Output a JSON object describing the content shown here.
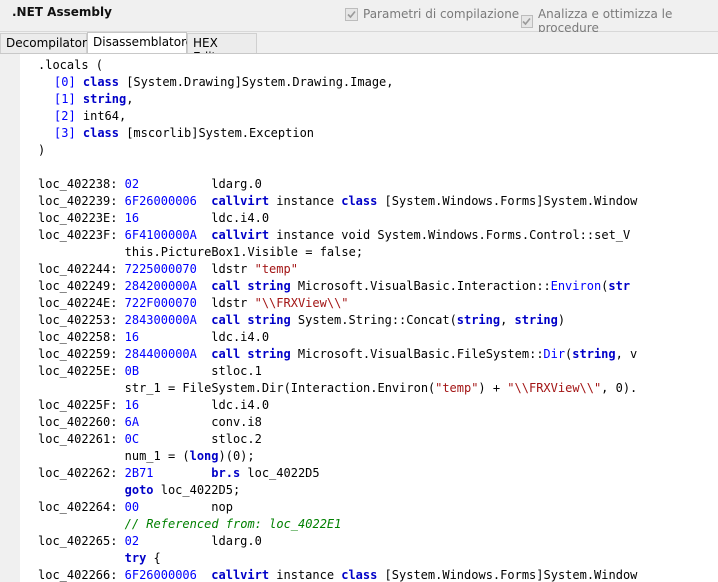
{
  "header": {
    "title": ".NET Assembly",
    "option1": "Parametri di compilazione",
    "option2": "Analizza e ottimizza le procedure"
  },
  "tabs": [
    "Decompilatore",
    "Disassemblatore",
    "HEX Editor"
  ],
  "code_lines": [
    {
      "x": 18,
      "segs": [
        {
          "t": ".locals (",
          "c": "plain"
        }
      ]
    },
    {
      "x": 34,
      "segs": [
        {
          "t": "[0]",
          "c": "num"
        },
        {
          "t": " class",
          "c": "kw"
        },
        {
          "t": " [System.Drawing]System.Drawing.Image,",
          "c": "plain"
        }
      ]
    },
    {
      "x": 34,
      "segs": [
        {
          "t": "[1]",
          "c": "num"
        },
        {
          "t": " string",
          "c": "kw"
        },
        {
          "t": ",",
          "c": "plain"
        }
      ]
    },
    {
      "x": 34,
      "segs": [
        {
          "t": "[2]",
          "c": "num"
        },
        {
          "t": " int64,",
          "c": "plain"
        }
      ]
    },
    {
      "x": 34,
      "segs": [
        {
          "t": "[3]",
          "c": "num"
        },
        {
          "t": " class",
          "c": "kw"
        },
        {
          "t": " [mscorlib]System.Exception",
          "c": "plain"
        }
      ]
    },
    {
      "x": 18,
      "segs": [
        {
          "t": ")",
          "c": "plain"
        }
      ]
    },
    {
      "x": 18,
      "segs": []
    },
    {
      "x": 18,
      "segs": [
        {
          "t": "loc_402238:",
          "c": "plain"
        },
        {
          "t": "02",
          "c": "num",
          "col": 12
        },
        {
          "t": "ldarg.0",
          "c": "plain",
          "col": 24
        }
      ]
    },
    {
      "x": 18,
      "segs": [
        {
          "t": "loc_402239:",
          "c": "plain"
        },
        {
          "t": "6F26000006",
          "c": "num",
          "col": 12
        },
        {
          "t": "callvirt",
          "c": "kw",
          "col": 24
        },
        {
          "t": "instance",
          "c": "plain",
          "col": 33
        },
        {
          "t": "class",
          "c": "kw",
          "col": 42
        },
        {
          "t": "[System.Windows.Forms]System.Window",
          "c": "plain",
          "col": 48
        }
      ]
    },
    {
      "x": 18,
      "segs": [
        {
          "t": "loc_40223E:",
          "c": "plain"
        },
        {
          "t": "16",
          "c": "num",
          "col": 12
        },
        {
          "t": "ldc.i4.0",
          "c": "plain",
          "col": 24
        }
      ]
    },
    {
      "x": 18,
      "segs": [
        {
          "t": "loc_40223F:",
          "c": "plain"
        },
        {
          "t": "6F4100000A",
          "c": "num",
          "col": 12
        },
        {
          "t": "callvirt",
          "c": "kw",
          "col": 24
        },
        {
          "t": "instance void System.Windows.Forms.Control::set_V",
          "c": "plain",
          "col": 33
        }
      ]
    },
    {
      "x": 18,
      "segs": [
        {
          "t": "this.PictureBox1.Visible = false;",
          "c": "plain",
          "col": 12
        }
      ]
    },
    {
      "x": 18,
      "segs": [
        {
          "t": "loc_402244:",
          "c": "plain"
        },
        {
          "t": "7225000070",
          "c": "num",
          "col": 12
        },
        {
          "t": "ldstr",
          "c": "plain",
          "col": 24
        },
        {
          "t": "\"temp\"",
          "c": "str",
          "col": 30
        }
      ]
    },
    {
      "x": 18,
      "segs": [
        {
          "t": "loc_402249:",
          "c": "plain"
        },
        {
          "t": "284200000A",
          "c": "num",
          "col": 12
        },
        {
          "t": "call",
          "c": "kw",
          "col": 24
        },
        {
          "t": "string",
          "c": "kw",
          "col": 29
        },
        {
          "t": "Microsoft.VisualBasic.Interaction::",
          "c": "plain",
          "col": 36
        },
        {
          "t": "Environ",
          "c": "num",
          "col": 71
        },
        {
          "t": "(",
          "c": "plain",
          "col": 78
        },
        {
          "t": "str",
          "c": "kw",
          "col": 79
        }
      ]
    },
    {
      "x": 18,
      "segs": [
        {
          "t": "loc_40224E:",
          "c": "plain"
        },
        {
          "t": "722F000070",
          "c": "num",
          "col": 12
        },
        {
          "t": "ldstr",
          "c": "plain",
          "col": 24
        },
        {
          "t": "\"\\\\FRXView\\\\\"",
          "c": "str",
          "col": 30
        }
      ]
    },
    {
      "x": 18,
      "segs": [
        {
          "t": "loc_402253:",
          "c": "plain"
        },
        {
          "t": "284300000A",
          "c": "num",
          "col": 12
        },
        {
          "t": "call",
          "c": "kw",
          "col": 24
        },
        {
          "t": "string",
          "c": "kw",
          "col": 29
        },
        {
          "t": "System.String::Concat(",
          "c": "plain",
          "col": 36
        },
        {
          "t": "string",
          "c": "kw",
          "col": 58
        },
        {
          "t": ",",
          "c": "plain",
          "col": 64
        },
        {
          "t": "string",
          "c": "kw",
          "col": 66
        },
        {
          "t": ")",
          "c": "plain",
          "col": 72
        }
      ]
    },
    {
      "x": 18,
      "segs": [
        {
          "t": "loc_402258:",
          "c": "plain"
        },
        {
          "t": "16",
          "c": "num",
          "col": 12
        },
        {
          "t": "ldc.i4.0",
          "c": "plain",
          "col": 24
        }
      ]
    },
    {
      "x": 18,
      "segs": [
        {
          "t": "loc_402259:",
          "c": "plain"
        },
        {
          "t": "284400000A",
          "c": "num",
          "col": 12
        },
        {
          "t": "call",
          "c": "kw",
          "col": 24
        },
        {
          "t": "string",
          "c": "kw",
          "col": 29
        },
        {
          "t": "Microsoft.VisualBasic.FileSystem::",
          "c": "plain",
          "col": 36
        },
        {
          "t": "Dir",
          "c": "num",
          "col": 70
        },
        {
          "t": "(",
          "c": "plain",
          "col": 73
        },
        {
          "t": "string",
          "c": "kw",
          "col": 74
        },
        {
          "t": ", v",
          "c": "plain",
          "col": 80
        }
      ]
    },
    {
      "x": 18,
      "segs": [
        {
          "t": "loc_40225E:",
          "c": "plain"
        },
        {
          "t": "0B",
          "c": "num",
          "col": 12
        },
        {
          "t": "stloc.1",
          "c": "plain",
          "col": 24
        }
      ]
    },
    {
      "x": 18,
      "segs": [
        {
          "t": "str_1 = FileSystem.Dir(Interaction.Environ(",
          "c": "plain",
          "col": 12
        },
        {
          "t": "\"temp\"",
          "c": "str",
          "col": 55
        },
        {
          "t": ") +",
          "c": "plain",
          "col": 61
        },
        {
          "t": "\"\\\\FRXView\\\\\"",
          "c": "str",
          "col": 65
        },
        {
          "t": ", 0).",
          "c": "plain",
          "col": 78
        }
      ]
    },
    {
      "x": 18,
      "segs": [
        {
          "t": "loc_40225F:",
          "c": "plain"
        },
        {
          "t": "16",
          "c": "num",
          "col": 12
        },
        {
          "t": "ldc.i4.0",
          "c": "plain",
          "col": 24
        }
      ]
    },
    {
      "x": 18,
      "segs": [
        {
          "t": "loc_402260:",
          "c": "plain"
        },
        {
          "t": "6A",
          "c": "num",
          "col": 12
        },
        {
          "t": "conv.i8",
          "c": "plain",
          "col": 24
        }
      ]
    },
    {
      "x": 18,
      "segs": [
        {
          "t": "loc_402261:",
          "c": "plain"
        },
        {
          "t": "0C",
          "c": "num",
          "col": 12
        },
        {
          "t": "stloc.2",
          "c": "plain",
          "col": 24
        }
      ]
    },
    {
      "x": 18,
      "segs": [
        {
          "t": "num_1 = (",
          "c": "plain",
          "col": 12
        },
        {
          "t": "long",
          "c": "kw",
          "col": 21
        },
        {
          "t": ")(0);",
          "c": "plain",
          "col": 25
        }
      ]
    },
    {
      "x": 18,
      "segs": [
        {
          "t": "loc_402262:",
          "c": "plain"
        },
        {
          "t": "2B71",
          "c": "num",
          "col": 12
        },
        {
          "t": "br.s",
          "c": "kw",
          "col": 24
        },
        {
          "t": "loc_4022D5",
          "c": "plain",
          "col": 29
        }
      ]
    },
    {
      "x": 18,
      "segs": [
        {
          "t": "goto",
          "c": "kw",
          "col": 12
        },
        {
          "t": "loc_4022D5;",
          "c": "plain",
          "col": 17
        }
      ]
    },
    {
      "x": 18,
      "segs": [
        {
          "t": "loc_402264:",
          "c": "plain"
        },
        {
          "t": "00",
          "c": "num",
          "col": 12
        },
        {
          "t": "nop",
          "c": "plain",
          "col": 24
        }
      ]
    },
    {
      "x": 18,
      "segs": [
        {
          "t": "// Referenced from: loc_4022E1",
          "c": "cmt",
          "col": 12
        }
      ]
    },
    {
      "x": 18,
      "segs": [
        {
          "t": "loc_402265:",
          "c": "plain"
        },
        {
          "t": "02",
          "c": "num",
          "col": 12
        },
        {
          "t": "ldarg.0",
          "c": "plain",
          "col": 24
        }
      ]
    },
    {
      "x": 18,
      "segs": [
        {
          "t": "try",
          "c": "kw",
          "col": 12
        },
        {
          "t": "{",
          "c": "plain",
          "col": 16
        }
      ]
    },
    {
      "x": 18,
      "segs": [
        {
          "t": "loc_402266:",
          "c": "plain"
        },
        {
          "t": "6F26000006",
          "c": "num",
          "col": 12
        },
        {
          "t": "callvirt",
          "c": "kw",
          "col": 24
        },
        {
          "t": "instance",
          "c": "plain",
          "col": 33
        },
        {
          "t": "class",
          "c": "kw",
          "col": 42
        },
        {
          "t": "[System.Windows.Forms]System.Window",
          "c": "plain",
          "col": 48
        }
      ]
    }
  ]
}
